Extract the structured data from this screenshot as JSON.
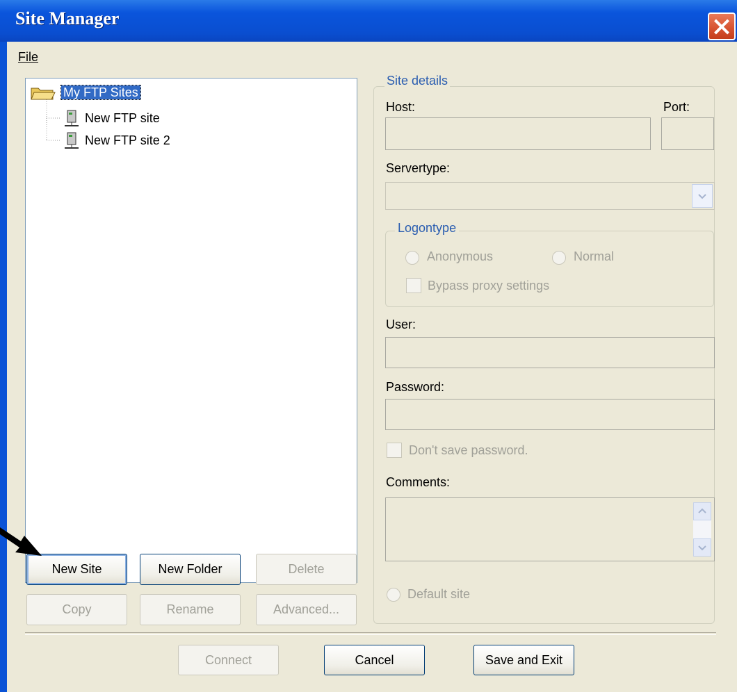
{
  "window": {
    "title": "Site Manager"
  },
  "menu": {
    "file": "File"
  },
  "tree": {
    "root": "My FTP Sites",
    "items": [
      "New FTP site",
      "New FTP site 2"
    ]
  },
  "details": {
    "group_label": "Site details",
    "host_label": "Host:",
    "port_label": "Port:",
    "host_value": "",
    "port_value": "",
    "servertype_label": "Servertype:",
    "servertype_value": "",
    "logon": {
      "label": "Logontype",
      "anonymous": "Anonymous",
      "normal": "Normal",
      "bypass": "Bypass proxy settings"
    },
    "user_label": "User:",
    "user_value": "",
    "password_label": "Password:",
    "password_value": "",
    "dont_save": "Don't save password.",
    "comments_label": "Comments:",
    "comments_value": "",
    "default_site": "Default site"
  },
  "buttons": {
    "new_site": "New Site",
    "new_folder": "New Folder",
    "delete": "Delete",
    "copy": "Copy",
    "rename": "Rename",
    "advanced": "Advanced...",
    "connect": "Connect",
    "cancel": "Cancel",
    "save_exit": "Save and Exit"
  },
  "colors": {
    "titlebar": "#0a55dc",
    "selection": "#316ac5",
    "face": "#ece9d8",
    "group_label": "#2a5db0"
  }
}
